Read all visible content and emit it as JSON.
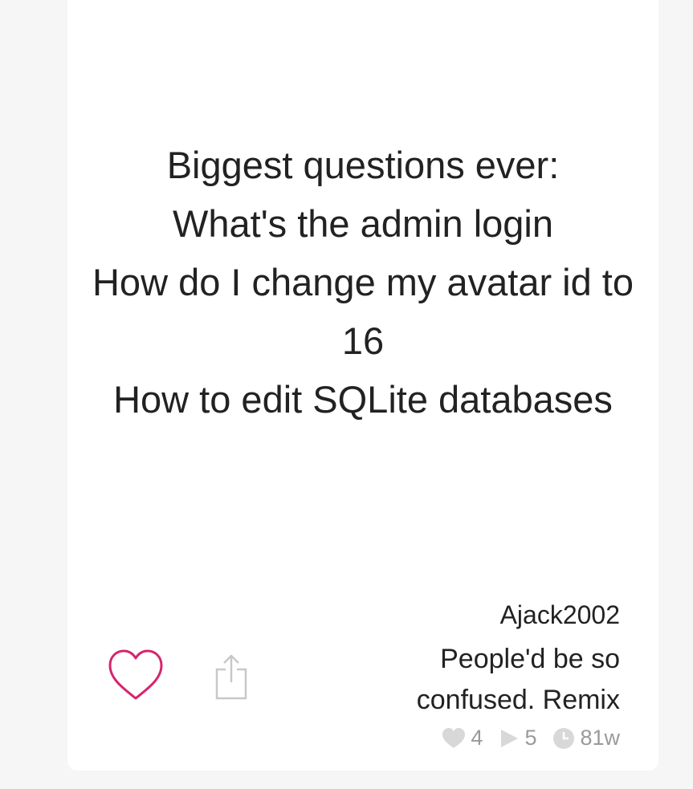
{
  "post": {
    "text_lines": [
      "Biggest questions ever:",
      "What's the admin login",
      "How do I change my avatar id to",
      "16",
      "How to edit SQLite databases"
    ],
    "username": "Ajack2002",
    "caption": "People'd be so confused. Remix",
    "stats": {
      "likes": "4",
      "plays": "5",
      "age": "81w"
    }
  },
  "icons": {
    "like": "heart-outline-icon",
    "share": "share-icon",
    "likes_stat": "heart-icon",
    "plays_stat": "play-icon",
    "age_stat": "clock-icon"
  },
  "colors": {
    "accent": "#d6246e",
    "muted": "#9a9a9a",
    "background": "#f6f6f6"
  }
}
